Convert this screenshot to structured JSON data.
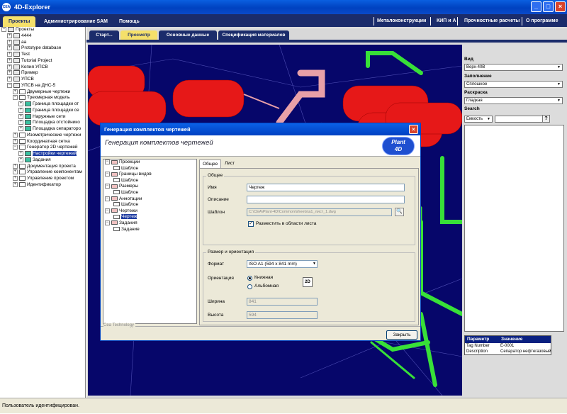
{
  "window": {
    "title": "4D-Explorer",
    "app_icon": "CEA"
  },
  "menu": {
    "tabs": [
      "Проекты",
      "Администрирование SAM",
      "Помощь"
    ],
    "right": [
      "Металоконструкции",
      "КИП и А",
      "Прочностные расчеты",
      "О программе"
    ]
  },
  "content_tabs": [
    "Старт...",
    "Просмотр",
    "Основные данные",
    "Спецификация материалов"
  ],
  "tree": {
    "items": [
      {
        "label": "Проекты",
        "level": 0
      },
      {
        "label": "4444",
        "level": 1
      },
      {
        "label": "aa",
        "level": 1
      },
      {
        "label": "Prototype database",
        "level": 1
      },
      {
        "label": "Test",
        "level": 1
      },
      {
        "label": "Tutorial Project",
        "level": 1
      },
      {
        "label": "Копия УПСВ",
        "level": 1
      },
      {
        "label": "Пример",
        "level": 1
      },
      {
        "label": "УПСВ",
        "level": 1
      },
      {
        "label": "УПСВ на ДНС-5",
        "level": 1
      },
      {
        "label": "Двумерные чертежи",
        "level": 2
      },
      {
        "label": "Трехмерная модель",
        "level": 2
      },
      {
        "label": "Граница площадки от",
        "level": 3
      },
      {
        "label": "Граница площадки се",
        "level": 3
      },
      {
        "label": "Наружные сети",
        "level": 3
      },
      {
        "label": "Площадка отстойнико",
        "level": 3
      },
      {
        "label": "Площадка сепараторо",
        "level": 3
      },
      {
        "label": "Изометрические чертежи",
        "level": 2
      },
      {
        "label": "Координатная сетка",
        "level": 2
      },
      {
        "label": "Генератор 2D чертежей",
        "level": 2
      },
      {
        "label": "Настройки чертежей",
        "level": 3
      },
      {
        "label": "Задания",
        "level": 3
      },
      {
        "label": "Документация проекта",
        "level": 2
      },
      {
        "label": "Управление компонентам",
        "level": 2
      },
      {
        "label": "Управление проектом",
        "level": 2
      },
      {
        "label": "Идентификатор",
        "level": 2
      }
    ],
    "selected_index": 20
  },
  "right_panel": {
    "view_label": "Вид",
    "view_value": "Верх-40В",
    "fill_label": "Заполнение",
    "fill_value": "Сплошное",
    "color_label": "Раскраска",
    "color_value": "Гладкая",
    "search_label": "Search",
    "search_value": "Емкость",
    "help_button": "?"
  },
  "params": {
    "header_param": "Параметр",
    "header_value": "Значение",
    "rows": [
      {
        "param": "Tag Number",
        "value": "E-0001"
      },
      {
        "param": "Description",
        "value": "Сепаратор нефтегазовый"
      }
    ]
  },
  "status": {
    "text": "Пользователь идентифицирован."
  },
  "dialog": {
    "title": "Генерация комплектов чертежей",
    "heading": "Генерация комплектов чертежей",
    "logo_line1": "Plant",
    "logo_line2": "4D",
    "tree": [
      {
        "label": "Проекции",
        "level": 0
      },
      {
        "label": "Шаблон",
        "level": 1
      },
      {
        "label": "Границы видов",
        "level": 0
      },
      {
        "label": "Шаблон",
        "level": 1
      },
      {
        "label": "Размеры",
        "level": 0
      },
      {
        "label": "Шаблон",
        "level": 1
      },
      {
        "label": "Аннотации",
        "level": 0
      },
      {
        "label": "Шаблон",
        "level": 1
      },
      {
        "label": "Чертежи",
        "level": 0
      },
      {
        "label": "Чертеж",
        "level": 1
      },
      {
        "label": "Задания",
        "level": 0
      },
      {
        "label": "Задание",
        "level": 1
      }
    ],
    "tree_selected": 9,
    "tabs": [
      "Общее",
      "Лист"
    ],
    "general_group": "Общее",
    "name_label": "Имя",
    "name_value": "Чертеж",
    "desc_label": "Описание",
    "desc_value": "",
    "template_label": "Шаблон",
    "template_value": "C:\\CEA\\Plant-4D\\Common\\sheets\\a1_лист_1.dwg",
    "place_label": "Разместить в области листа",
    "place_checked": true,
    "size_group": "Размер и ориентация",
    "format_label": "Формат",
    "format_value": "ISO A1 (594 x 841 mm)",
    "orientation_label": "Ориентация",
    "portrait_label": "Книжная",
    "landscape_label": "Альбомная",
    "orientation_selected": "Книжная",
    "orient_icon": "2D",
    "width_label": "Ширина",
    "width_value": "841",
    "height_label": "Высота",
    "height_value": "594",
    "company": "Cea Technology",
    "close_button": "Закрыть"
  },
  "colors": {
    "accent": "#1b2c6b",
    "active_tab": "#f5e06a",
    "title_blue": "#0042c0",
    "viewport_bg": "#06066a",
    "vessel_red": "#e61818",
    "pipe_green": "#38e038",
    "pipe_pink": "#e8a0a8"
  }
}
